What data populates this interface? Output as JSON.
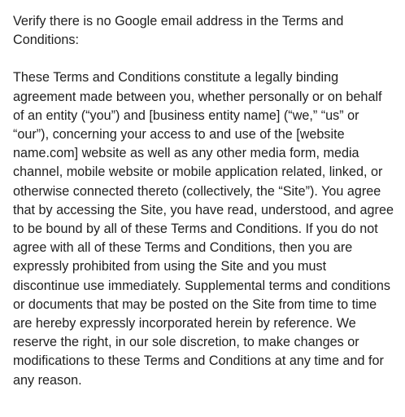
{
  "instruction": "Verify there is no Google email address in the Terms and Conditions:",
  "terms_text": "These Terms and Conditions constitute a legally binding agreement made between you, whether personally or on behalf of an entity (“you”) and [business entity name] (“we,” “us” or “our”), concerning your access to and use of the [website name.com] website as well as any other media form, media channel, mobile website or mobile application related, linked, or otherwise connected thereto (collectively, the “Site”). You agree that by accessing the Site, you have read, understood, and agree to be bound by all of these Terms and Conditions. If you do not agree with all of these Terms and Conditions, then you are expressly prohibited from using the Site and you must discontinue use immediately. Supplemental terms and conditions or documents that may be posted on the Site from time to time are hereby expressly incorporated herein by reference. We reserve the right, in our sole discretion, to make changes or modifications to these Terms and Conditions at any time and for any reason."
}
